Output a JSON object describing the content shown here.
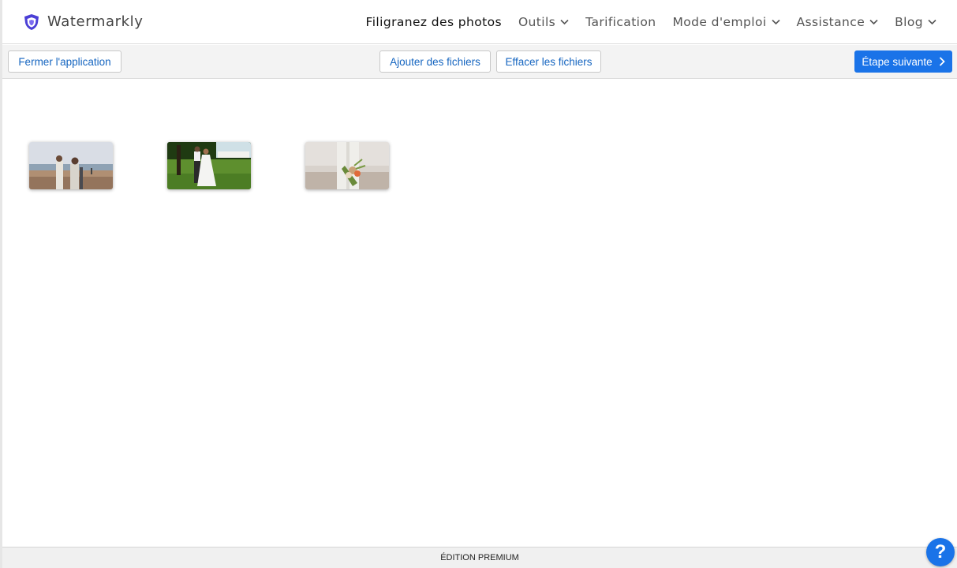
{
  "app": {
    "brand_name": "Watermarkly",
    "brand_icon": "shield-icon",
    "accent_color": "#1a73e8"
  },
  "nav": {
    "items": [
      {
        "label": "Filigranez des photos",
        "active": true,
        "has_dropdown": false
      },
      {
        "label": "Outils",
        "active": false,
        "has_dropdown": true
      },
      {
        "label": "Tarification",
        "active": false,
        "has_dropdown": false
      },
      {
        "label": "Mode d'emploi",
        "active": false,
        "has_dropdown": true
      },
      {
        "label": "Assistance",
        "active": false,
        "has_dropdown": true
      },
      {
        "label": "Blog",
        "active": false,
        "has_dropdown": true
      }
    ]
  },
  "toolbar": {
    "close_label": "Fermer l'application",
    "add_label": "Ajouter des fichiers",
    "clear_label": "Effacer les fichiers",
    "next_label": "Étape suivante",
    "next_icon": "chevron-right-icon"
  },
  "files": [
    {
      "thumbnail": "beach-wedding-photo"
    },
    {
      "thumbnail": "garden-wedding-photo"
    },
    {
      "thumbnail": "bouquet-wedding-photo"
    }
  ],
  "footer": {
    "edition_label": "ÉDITION PREMIUM"
  },
  "help": {
    "label": "?",
    "icon": "help-icon"
  }
}
